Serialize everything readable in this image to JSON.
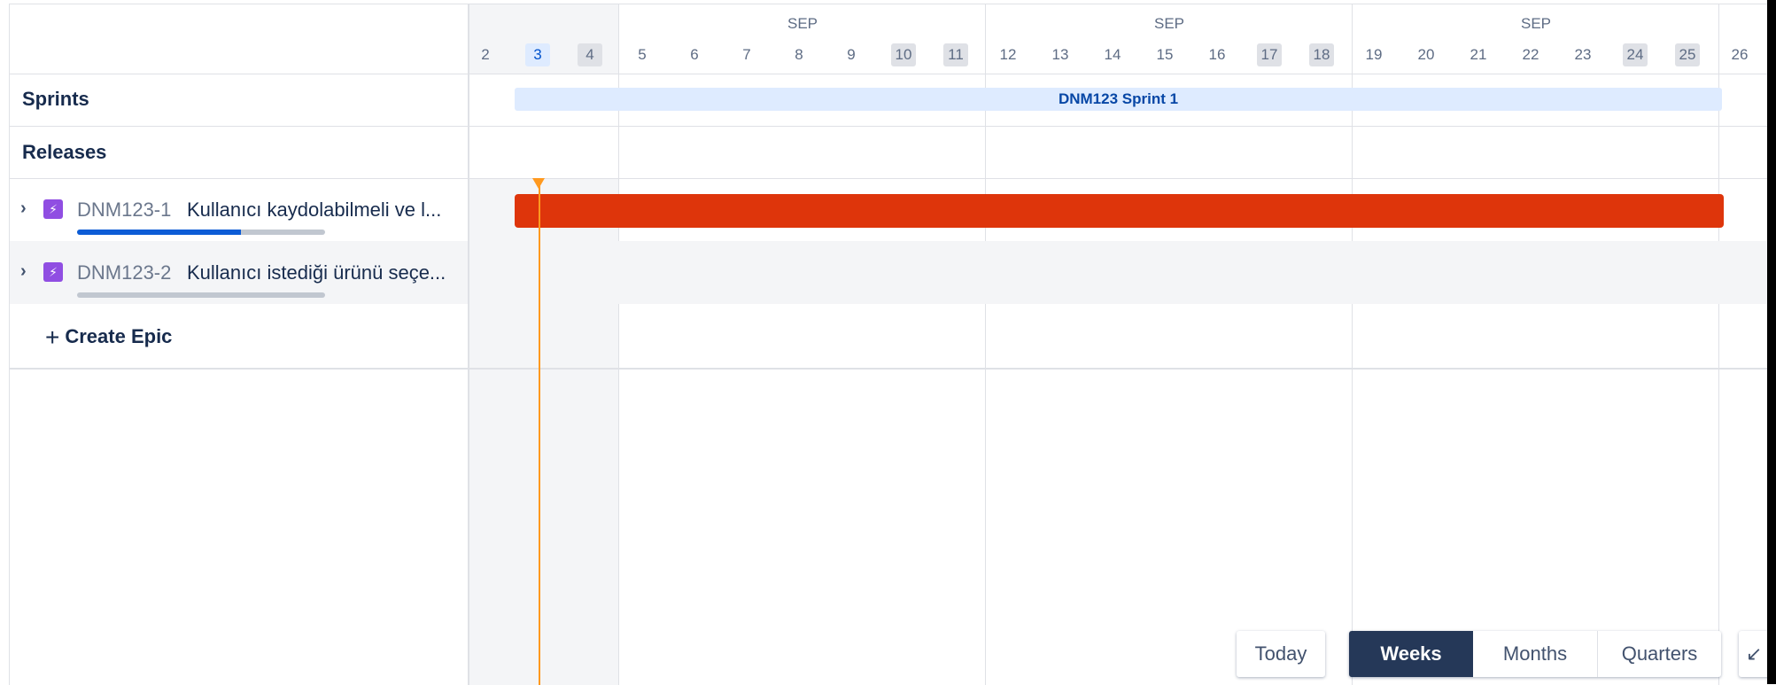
{
  "timeline": {
    "months": [
      "SEP",
      "SEP",
      "SEP"
    ],
    "days": [
      "2",
      "3",
      "4",
      "5",
      "6",
      "7",
      "8",
      "9",
      "10",
      "11",
      "12",
      "13",
      "14",
      "15",
      "16",
      "17",
      "18",
      "19",
      "20",
      "21",
      "22",
      "23",
      "24",
      "25",
      "26"
    ]
  },
  "rows": {
    "sprints_label": "Sprints",
    "releases_label": "Releases",
    "sprint_bar_label": "DNM123 Sprint 1"
  },
  "epics": [
    {
      "key": "DNM123-1",
      "title": "Kullanıcı kaydolabilmeli ve l...",
      "progress": 0.66,
      "icon": "lightning-icon",
      "color": "#de350b"
    },
    {
      "key": "DNM123-2",
      "title": "Kullanıcı istediği ürünü seçe...",
      "progress": 0.0,
      "icon": "lightning-icon"
    }
  ],
  "create_epic_label": "Create Epic",
  "controls": {
    "today": "Today",
    "weeks": "Weeks",
    "months": "Months",
    "quarters": "Quarters",
    "active": "Weeks"
  },
  "colors": {
    "today_line": "#ff991f",
    "epic_icon": "#904ee2",
    "active_segment": "#253858"
  }
}
